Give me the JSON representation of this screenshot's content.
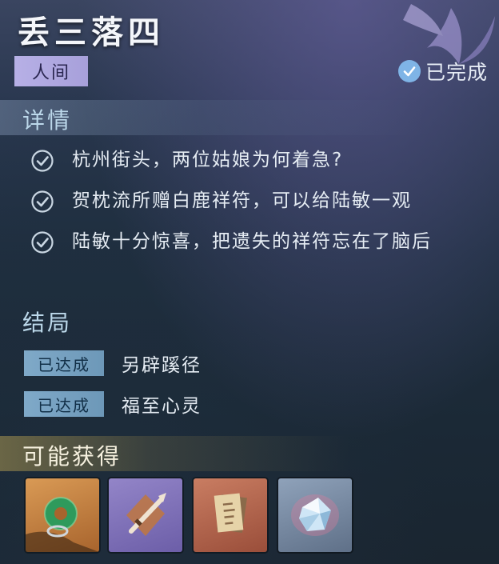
{
  "quest": {
    "title": "丢三落四",
    "world_tag": "人间",
    "status": "已完成"
  },
  "details": {
    "heading": "详情",
    "items": [
      {
        "text": "杭州街头，两位姑娘为何着急?"
      },
      {
        "text": "贺枕流所赠白鹿祥符，可以给陆敏一观"
      },
      {
        "text": "陆敏十分惊喜，把遗失的祥符忘在了脑后"
      }
    ]
  },
  "endings": {
    "heading": "结局",
    "items": [
      {
        "badge": "已达成",
        "text": "另辟蹊径"
      },
      {
        "badge": "已达成",
        "text": "福至心灵"
      }
    ]
  },
  "rewards": {
    "heading": "可能获得",
    "items": [
      {
        "icon": "jade-pendant-icon",
        "rarity_color": "#c07a3a"
      },
      {
        "icon": "crossed-weapon-icon",
        "rarity_color": "#7f6fb5"
      },
      {
        "icon": "paper-talisman-icon",
        "rarity_color": "#b8674e"
      },
      {
        "icon": "ice-crystal-icon",
        "rarity_color": "#7c8fa8"
      }
    ]
  },
  "colors": {
    "accent_purple": "#b7b0e6",
    "accent_blue": "#7fa9c8",
    "check_blue": "#7fb4e6"
  }
}
